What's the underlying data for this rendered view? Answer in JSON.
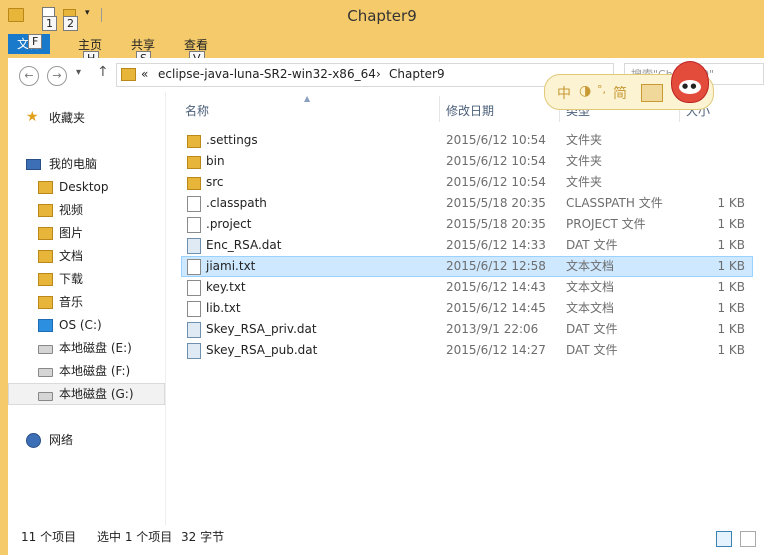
{
  "window": {
    "title": "Chapter9"
  },
  "qat": {
    "keytip_1": "1",
    "keytip_2": "2",
    "dropdown": "▾"
  },
  "ribbon": {
    "tabs": [
      {
        "label": "文件",
        "keytip": "F"
      },
      {
        "label": "主页",
        "keytip": "H"
      },
      {
        "label": "共享",
        "keytip": "S"
      },
      {
        "label": "查看",
        "keytip": "V"
      }
    ]
  },
  "nav": {
    "back": "←",
    "forward": "→",
    "recent": "▾",
    "up": "↑",
    "path_chevrons": "«",
    "breadcrumb": [
      "eclipse-java-luna-SR2-win32-x86_64",
      "Chapter9"
    ],
    "breadcrumb_sep": "›",
    "search_placeholder": "搜索\"Chapter9\""
  },
  "ime": {
    "items": [
      "中",
      "◑",
      "°,",
      "简"
    ]
  },
  "sidebar": {
    "favorites": "收藏夹",
    "this_pc": "我的电脑",
    "items": [
      {
        "label": "Desktop"
      },
      {
        "label": "视频"
      },
      {
        "label": "图片"
      },
      {
        "label": "文档"
      },
      {
        "label": "下载"
      },
      {
        "label": "音乐"
      },
      {
        "label": "OS (C:)"
      },
      {
        "label": "本地磁盘 (E:)"
      },
      {
        "label": "本地磁盘 (F:)"
      },
      {
        "label": "本地磁盘 (G:)"
      }
    ],
    "network": "网络"
  },
  "columns": {
    "name": "名称",
    "date": "修改日期",
    "type": "类型",
    "size": "大小"
  },
  "files": [
    {
      "name": ".settings",
      "date": "2015/6/12 10:54",
      "type": "文件夹",
      "size": "",
      "icon": "folder"
    },
    {
      "name": "bin",
      "date": "2015/6/12 10:54",
      "type": "文件夹",
      "size": "",
      "icon": "folder"
    },
    {
      "name": "src",
      "date": "2015/6/12 10:54",
      "type": "文件夹",
      "size": "",
      "icon": "folder"
    },
    {
      "name": ".classpath",
      "date": "2015/5/18 20:35",
      "type": "CLASSPATH 文件",
      "size": "1 KB",
      "icon": "doc"
    },
    {
      "name": ".project",
      "date": "2015/5/18 20:35",
      "type": "PROJECT 文件",
      "size": "1 KB",
      "icon": "doc"
    },
    {
      "name": "Enc_RSA.dat",
      "date": "2015/6/12 14:33",
      "type": "DAT 文件",
      "size": "1 KB",
      "icon": "dat"
    },
    {
      "name": "jiami.txt",
      "date": "2015/6/12 12:58",
      "type": "文本文档",
      "size": "1 KB",
      "icon": "doc"
    },
    {
      "name": "key.txt",
      "date": "2015/6/12 14:43",
      "type": "文本文档",
      "size": "1 KB",
      "icon": "doc"
    },
    {
      "name": "lib.txt",
      "date": "2015/6/12 14:45",
      "type": "文本文档",
      "size": "1 KB",
      "icon": "doc"
    },
    {
      "name": "Skey_RSA_priv.dat",
      "date": "2013/9/1 22:06",
      "type": "DAT 文件",
      "size": "1 KB",
      "icon": "dat"
    },
    {
      "name": "Skey_RSA_pub.dat",
      "date": "2015/6/12 14:27",
      "type": "DAT 文件",
      "size": "1 KB",
      "icon": "dat"
    }
  ],
  "status": {
    "item_count": "11 个项目",
    "selected": "选中 1 个项目",
    "selected_size": "32 字节"
  }
}
